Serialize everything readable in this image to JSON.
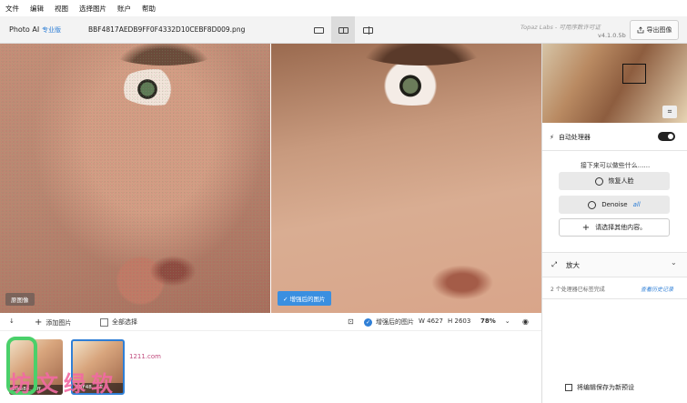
{
  "menu": {
    "items": [
      "文件",
      "编辑",
      "视图",
      "选择图片",
      "账户",
      "帮助"
    ]
  },
  "toolbar": {
    "app_title": "Photo AI",
    "app_badge": "专业版",
    "file_name": "BBF4817AEDB9FF0F4332D10CEBF8D009.png",
    "brand": "Topaz Labs - 可用序数许可证",
    "version": "v4.1.0.5b",
    "export_label": "导出图像",
    "views": [
      {
        "name": "single",
        "active": false
      },
      {
        "name": "split",
        "active": true
      },
      {
        "name": "side-by-side",
        "active": false
      }
    ]
  },
  "preview": {
    "original_label": "原图像",
    "enhanced_label": "增强后的图片"
  },
  "bottombar": {
    "add_images": "添加图片",
    "select_all": "全部选择",
    "enhanced_label": "增强后的图片",
    "width_label": "W 4627",
    "height_label": "H 2603",
    "zoom": "78%"
  },
  "thumbnails": [
    {
      "label": "8fae84...8ff...",
      "selected": false
    },
    {
      "label": "BBF48...CE...",
      "selected": true
    }
  ],
  "watermark": {
    "text": "坊文绿软",
    "url": "1211.com"
  },
  "panel": {
    "autopilot_label": "自动处理器",
    "autopilot_on": true,
    "suggest_title": "接下来可以做些什么......",
    "buttons": {
      "recover_faces": "恢复人脸",
      "denoise": "Denoise",
      "denoise_tag": "all",
      "add_more": "请选择其他内容。"
    },
    "upscale_label": "放大",
    "status_text": "2 个处理器已标签完成",
    "history_link": "查看历史记录",
    "save_preset": "将编辑保存为新预设"
  },
  "colors": {
    "accent": "#2f7fd6",
    "watermark": "#f36aa3"
  }
}
